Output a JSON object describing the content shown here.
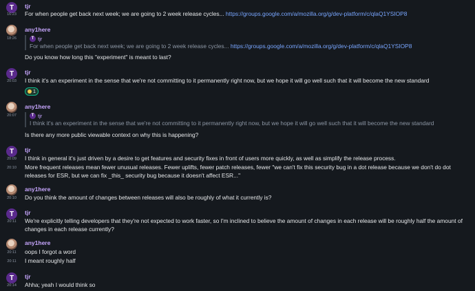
{
  "messages": [
    {
      "sender": "tjr",
      "avatar": "T",
      "time": "16:23",
      "text": "For when people get back next week; we are going to 2 week release cycles... ",
      "link": "https://groups.google.com/a/mozilla.org/g/dev-platform/c/qlaQ1YSIOP8"
    },
    {
      "sender": "any1here",
      "time": "18:26",
      "quote_sender": "tjr",
      "quote_avatar": "T",
      "quote_text": "For when people get back next week; we are going to 2 week release cycles... ",
      "quote_link": "https://groups.google.com/a/mozilla.org/g/dev-platform/c/qlaQ1YSIOP8",
      "text": "Do you know how long this \"experiment\" is meant to last?"
    },
    {
      "sender": "tjr",
      "avatar": "T",
      "time": "20:03",
      "text": "I think it's an experiment in the sense that we're not committing to it permanently right now, but we hope it will go well such that it will become the new standard",
      "reaction_count": "1"
    },
    {
      "sender": "any1here",
      "time": "20:07",
      "quote_sender": "tjr",
      "quote_avatar": "T",
      "quote_text": "I think it's an experiment in the sense that we're not committing to it permanently right now, but we hope it will go well such that it will become the new standard",
      "text": "Is there any more public viewable context on why this is happening?"
    },
    {
      "sender": "tjr",
      "avatar": "T",
      "time1": "20:09",
      "time2": "20:10",
      "text1": "I think in general it's just driven by a desire to get features and security fixes in front of users more quickly, as well as simplify the release process.",
      "text2": "More frequent releases mean fewer unusual releases.  Fewer uplifts, fewer patch releases, fewer \"we can't fix this security bug in a dot release because we don't do dot releases for ESR, but we can fix _this_ security bug because it doesn't affect ESR...\""
    },
    {
      "sender": "any1here",
      "time": "20:10",
      "text": "Do you think the amount of changes between releases will also be roughly of what it currently is?"
    },
    {
      "sender": "tjr",
      "avatar": "T",
      "time": "20:11",
      "text": "We're explicitly telling developers that they're not expected to work faster, so I'm inclined to believe the amount of changes in each release will be roughly half the amount of changes in each release currently?"
    },
    {
      "sender": "any1here",
      "time1": "20:11",
      "time2": "20:11",
      "text1": "oops I forgot a word",
      "text2": "I meant roughly half"
    },
    {
      "sender": "tjr",
      "avatar": "T",
      "time": "20:14",
      "text": "Ahha; yeah I would think so"
    }
  ]
}
